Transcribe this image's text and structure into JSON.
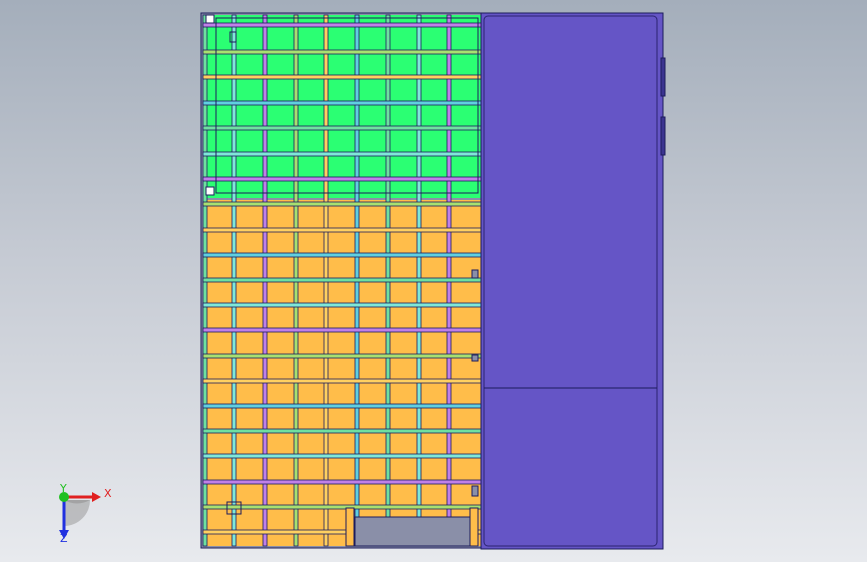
{
  "viewport": {
    "background_top": "#a4aebb",
    "background_bottom": "#e8eaee"
  },
  "model": {
    "upper_panel_color": "#2bff73",
    "lower_panel_color": "#ffbd4a",
    "side_panel_color": "#6555c6",
    "outline_color": "#1c1c5c",
    "bar_colors": [
      "#6fe0a0",
      "#7fe8d8",
      "#c080e8",
      "#a8e070",
      "#ffd060",
      "#60d0e0"
    ]
  },
  "triad": {
    "x_label": "X",
    "y_label": "Y",
    "z_label": "Z",
    "x_color": "#e02020",
    "y_color": "#20c020",
    "z_color": "#2030e0"
  }
}
